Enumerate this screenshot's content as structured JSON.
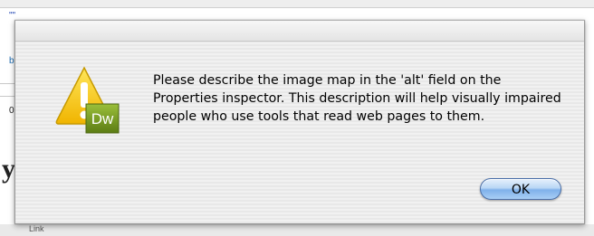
{
  "alert": {
    "message": "Please describe the image map in the 'alt' field on the Properties inspector. This description will help visually impaired people who use tools that read web pages to them.",
    "ok_label": "OK",
    "icon": "warning-icon",
    "badge_text": "Dw"
  },
  "background": {
    "frag_top": "\"\"",
    "frag_b": "b",
    "frag_0": "0",
    "frag_y": "y",
    "frag_bottom": "Link"
  },
  "colors": {
    "ok_button": "#8fbcef",
    "warning_yellow": "#f5c400",
    "dw_badge": "#6d8f1d"
  }
}
